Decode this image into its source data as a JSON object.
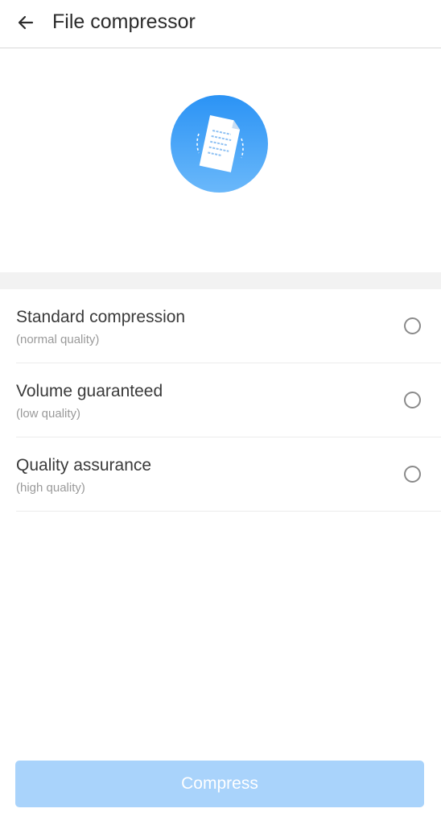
{
  "app_bar": {
    "title": "File compressor",
    "back_icon": "arrow-left-icon"
  },
  "hero": {
    "icon": "compressed-document-icon",
    "colors": {
      "circle_top": "#2b93f5",
      "circle_bottom": "#6ab8fa"
    }
  },
  "options": [
    {
      "title": "Standard compression",
      "subtitle": "(normal quality)",
      "selected": false
    },
    {
      "title": "Volume guaranteed",
      "subtitle": "(low quality)",
      "selected": false
    },
    {
      "title": "Quality assurance",
      "subtitle": "(high quality)",
      "selected": false
    }
  ],
  "compress_button": {
    "label": "Compress",
    "enabled": false,
    "color": "#a9d3fb"
  }
}
